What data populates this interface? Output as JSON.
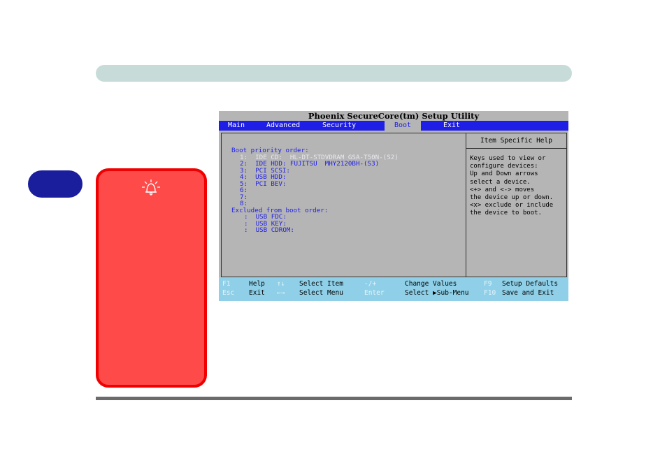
{
  "bios": {
    "title": "Phoenix SecureCore(tm) Setup Utility",
    "menu": [
      "Main",
      "Advanced",
      "Security",
      "Boot",
      "Exit"
    ],
    "active_menu": "Boot",
    "boot": {
      "heading": "Boot priority order:",
      "items": [
        "1:  IDE CD:  HL-DT-STDVDRAM GSA-T50N-(S2)",
        "2:  IDE HDD: FUJITSU  MHY2120BH-(S3)",
        "3:  PCI SCSI:",
        "4:  USB HDD:",
        "5:  PCI BEV:",
        "6:",
        "7:",
        "8:"
      ],
      "excluded_heading": "Excluded from boot order:",
      "excluded_items": [
        ":  USB FDC:",
        ":  USB KEY:",
        ":  USB CDROM:"
      ]
    },
    "help": {
      "title": "Item Specific Help",
      "lines": [
        "Keys used to view or",
        "configure devices:",
        "Up and Down arrows",
        "select a device.",
        "<+> and <-> moves",
        "the device up or down.",
        "<x> exclude or include",
        "the device to boot."
      ]
    },
    "footer": {
      "row1": [
        {
          "key": "F1",
          "desc": "Help"
        },
        {
          "key": "↑↓",
          "desc": "Select Item"
        },
        {
          "key": "-/+",
          "desc": "Change Values"
        },
        {
          "key": "F9",
          "desc": "Setup Defaults"
        }
      ],
      "row2": [
        {
          "key": "Esc",
          "desc": "Exit"
        },
        {
          "key": "←→",
          "desc": "Select Menu"
        },
        {
          "key": "Enter",
          "desc": "Select ▶Sub-Menu"
        },
        {
          "key": "F10",
          "desc": "Save and Exit"
        }
      ]
    }
  },
  "colors": {
    "bios_bg": "#b5b5b5",
    "bios_blue": "#1e1ee6",
    "footer_bg": "#8fd0e8",
    "note_bg": "#ff4a4a",
    "note_border": "#f00000",
    "chapter_tab": "#1a1d9c",
    "top_bar": "#c7dcd8"
  },
  "icons": {
    "note": "bell-icon"
  }
}
